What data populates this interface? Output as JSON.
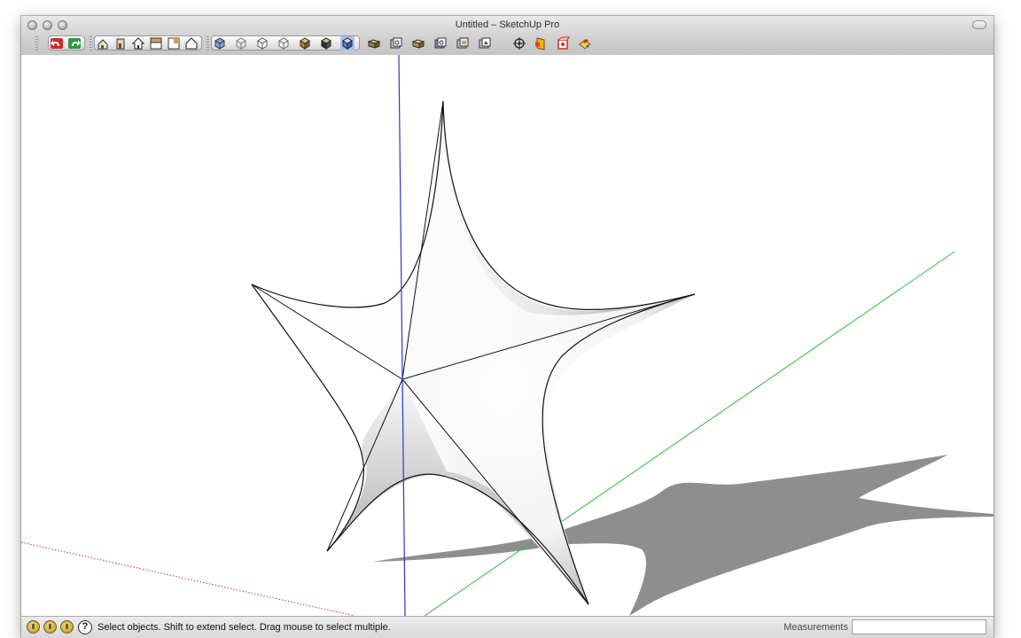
{
  "window": {
    "title": "Untitled – SketchUp Pro"
  },
  "toolbar": {
    "groups": [
      {
        "name": "edit",
        "items": [
          "undo-icon",
          "redo-icon"
        ]
      },
      {
        "name": "standard-views",
        "items": [
          "iso-view-icon",
          "right-view-icon",
          "front-view-icon",
          "top-view-icon",
          "back-view-icon",
          "left-view-icon"
        ]
      },
      {
        "name": "face-styles",
        "items": [
          "xray-icon",
          "wireframe-icon",
          "hidden-line-icon",
          "shaded-icon",
          "shaded-textures-icon",
          "monochrome-icon",
          "monochrome-selected-icon"
        ]
      },
      {
        "name": "camera",
        "items": [
          "orbit-icon",
          "pan-icon",
          "zoom-icon",
          "zoom-window-icon",
          "previous-view-icon",
          "zoom-extents-icon"
        ]
      },
      {
        "name": "sandbox",
        "items": [
          "crosshair-icon",
          "section-plane-icon",
          "components-icon",
          "paint-bucket-icon"
        ]
      }
    ]
  },
  "colors": {
    "axis_blue": "#3333cc",
    "axis_green": "#33cc33",
    "axis_red_dotted": "#cc3333",
    "shadow": "#8c8c8c",
    "surface_light": "#ffffff",
    "surface_dark": "#9a9a9a"
  },
  "statusbar": {
    "icons": [
      "geo-location-icon",
      "credits-icon",
      "user-icon"
    ],
    "help_glyph": "?",
    "message": "Select objects. Shift to extend select. Drag mouse to select multiple.",
    "measurements_label": "Measurements",
    "measurements_value": ""
  }
}
